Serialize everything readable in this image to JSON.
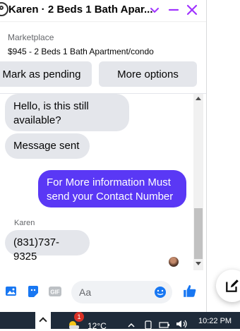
{
  "header": {
    "title": "Karen · 2 Beds 1 Bath Apar...",
    "accent_color": "#a033ff"
  },
  "listing": {
    "label": "Marketplace",
    "title": "$945 - 2 Beds 1 Bath Apartment/condo",
    "buttons": {
      "mark_pending": "Mark as pending",
      "more_options": "More options"
    }
  },
  "messages": [
    {
      "direction": "in",
      "text": "Hello, is this still available?"
    },
    {
      "direction": "in",
      "text": "Message sent"
    },
    {
      "direction": "out",
      "text": "For More information Must send your Contact Number"
    },
    {
      "direction": "in",
      "sender": "Karen",
      "text": "(831)737-9325"
    }
  ],
  "composer": {
    "placeholder": "Aa",
    "icons": [
      "photo-icon",
      "sticker-icon",
      "gif-icon",
      "emoji-icon",
      "like-icon"
    ],
    "accent_color": "#1877f2"
  },
  "float_button": {
    "icon": "new-message-icon"
  },
  "taskbar": {
    "temperature": "12°C",
    "time": "10:22 PM",
    "notification_count": "1"
  }
}
